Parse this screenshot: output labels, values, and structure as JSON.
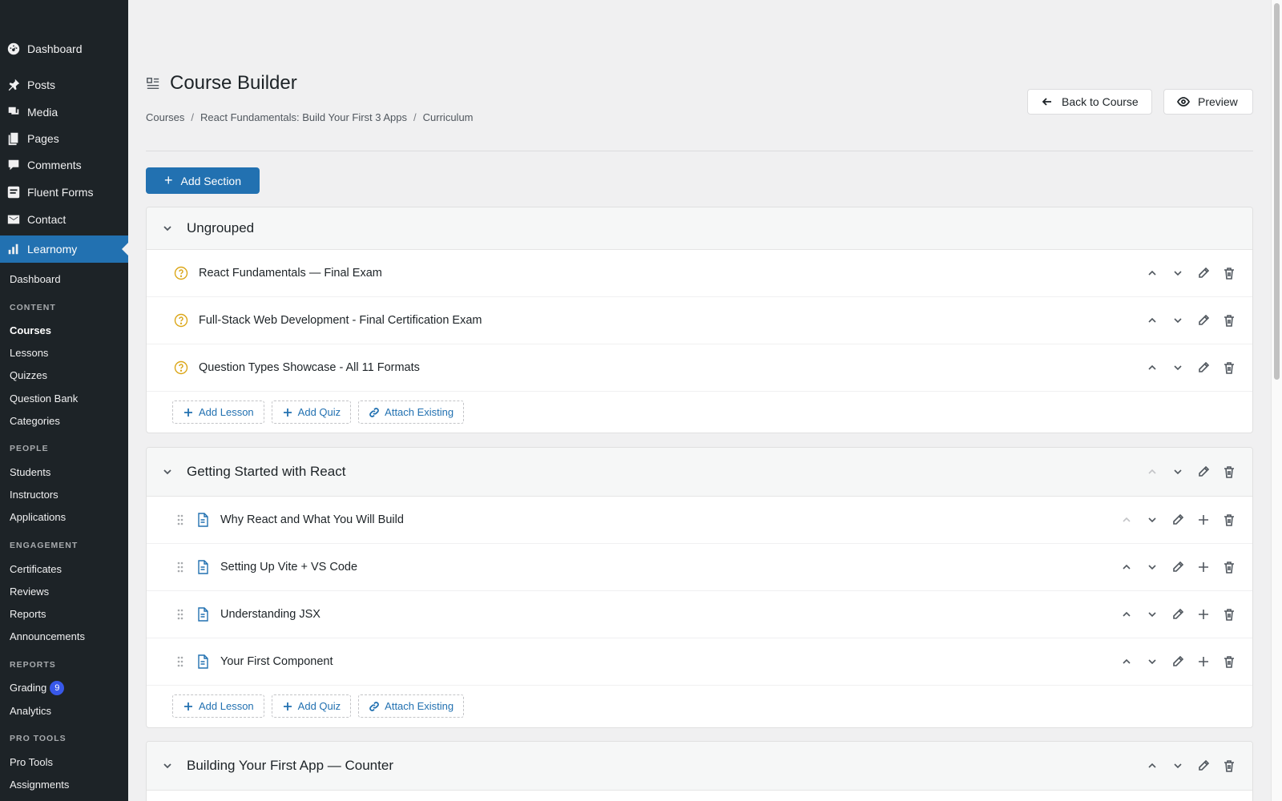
{
  "sidebar": {
    "top_items": [
      {
        "label": "Dashboard",
        "icon": "dashboard-icon"
      },
      {
        "label": "Posts",
        "icon": "pin-icon"
      },
      {
        "label": "Media",
        "icon": "media-icon"
      },
      {
        "label": "Pages",
        "icon": "pages-icon"
      },
      {
        "label": "Comments",
        "icon": "comments-icon"
      },
      {
        "label": "Fluent Forms",
        "icon": "forms-icon"
      },
      {
        "label": "Contact",
        "icon": "mail-icon"
      },
      {
        "label": "Learnomy",
        "icon": "chart-bars-icon"
      }
    ],
    "sub_dashboard": "Dashboard",
    "groups": [
      {
        "heading": "CONTENT",
        "items": [
          "Courses",
          "Lessons",
          "Quizzes",
          "Question Bank",
          "Categories"
        ]
      },
      {
        "heading": "PEOPLE",
        "items": [
          "Students",
          "Instructors",
          "Applications"
        ]
      },
      {
        "heading": "ENGAGEMENT",
        "items": [
          "Certificates",
          "Reviews",
          "Reports",
          "Announcements"
        ]
      },
      {
        "heading": "REPORTS",
        "items": [
          "Grading",
          "Analytics"
        ]
      },
      {
        "heading": "PRO TOOLS",
        "items": [
          "Pro Tools",
          "Assignments"
        ]
      }
    ],
    "grading_badge": "9",
    "accent_color": "#2271b1"
  },
  "header": {
    "title": "Course Builder",
    "breadcrumb": [
      "Courses",
      "React Fundamentals: Build Your First 3 Apps",
      "Curriculum"
    ],
    "breadcrumb_sep": "/",
    "back_label": "Back to Course",
    "preview_label": "Preview"
  },
  "toolbar": {
    "add_section_label": "Add Section"
  },
  "footer_actions": {
    "add_lesson": "Add Lesson",
    "add_quiz": "Add Quiz",
    "attach": "Attach Existing"
  },
  "sections": [
    {
      "title": "Ungrouped",
      "items": [
        {
          "title": "React Fundamentals — Final Exam",
          "type": "quiz"
        },
        {
          "title": "Full-Stack Web Development - Final Certification Exam",
          "type": "quiz"
        },
        {
          "title": "Question Types Showcase - All 11 Formats",
          "type": "quiz"
        }
      ]
    },
    {
      "title": "Getting Started with React",
      "items": [
        {
          "title": "Why React and What You Will Build",
          "type": "lesson"
        },
        {
          "title": "Setting Up Vite + VS Code",
          "type": "lesson"
        },
        {
          "title": "Understanding JSX",
          "type": "lesson"
        },
        {
          "title": "Your First Component",
          "type": "lesson"
        }
      ]
    },
    {
      "title": "Building Your First App — Counter",
      "items": []
    }
  ]
}
